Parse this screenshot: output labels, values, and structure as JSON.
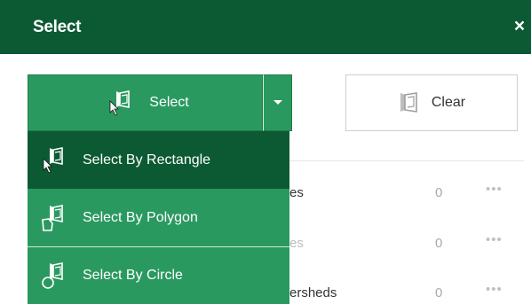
{
  "panel": {
    "title": "Select",
    "close_glyph": "×"
  },
  "toolbar": {
    "select_label": "Select",
    "clear_label": "Clear",
    "select_icon": "select-rectangle-icon",
    "clear_icon": "clear-selection-icon",
    "dropdown_icon": "caret-down-icon"
  },
  "menu": {
    "items": [
      {
        "label": "Select By Rectangle",
        "icon": "select-rectangle-icon",
        "active": true
      },
      {
        "label": "Select By Polygon",
        "icon": "select-polygon-icon",
        "active": false
      },
      {
        "label": "Select By Circle",
        "icon": "select-circle-icon",
        "active": false
      }
    ]
  },
  "layers": [
    {
      "name": "es",
      "count": "0",
      "more": "•••"
    },
    {
      "name": "es",
      "count": "0",
      "more": "•••"
    },
    {
      "name": "ersheds",
      "count": "0",
      "more": "•••"
    }
  ],
  "colors": {
    "header": "#0c5a33",
    "button": "#2a9960",
    "active_item": "#0c5a33"
  }
}
